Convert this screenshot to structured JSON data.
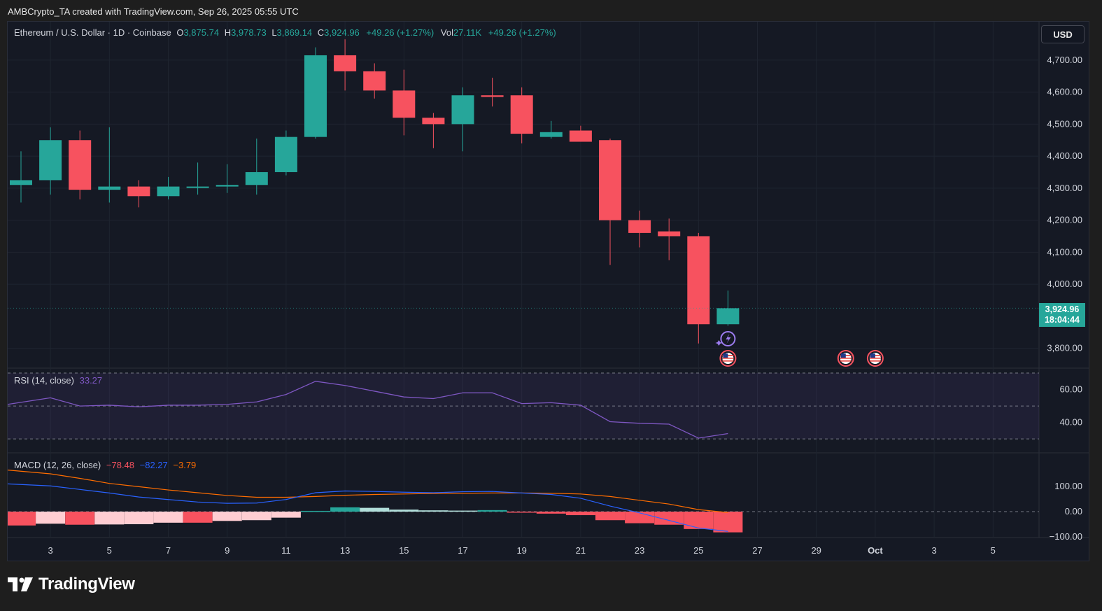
{
  "caption": "AMBCrypto_TA created with TradingView.com, Sep 26, 2025 05:55 UTC",
  "brand": "TradingView",
  "currency_button": "USD",
  "legend": {
    "symbol": "Ethereum / U.S. Dollar · 1D · Coinbase",
    "o_label": "O",
    "o_value": "3,875.74",
    "h_label": "H",
    "h_value": "3,978.73",
    "l_label": "L",
    "l_value": "3,869.14",
    "c_label": "C",
    "c_value": "3,924.96",
    "change": "+49.26 (+1.27%)",
    "vol_label": "Vol",
    "vol_value": "27.11K",
    "change2": "+49.26 (+1.27%)"
  },
  "rsi_legend": {
    "label": "RSI (14, close)",
    "value": "33.27"
  },
  "macd_legend": {
    "label": "MACD (12, 26, close)",
    "macd": "−78.48",
    "signal": "−82.27",
    "hist": "−3.79"
  },
  "last_price": {
    "value": "3,924.96",
    "countdown": "18:04:44"
  },
  "colors": {
    "up": "#26a69a",
    "down": "#f7525f",
    "rsi": "#7e57c2",
    "macd": "#2962ff",
    "signal": "#ff6d00",
    "hist_neg_strong": "#f7525f",
    "hist_neg_weak": "#ffcdd2",
    "hist_pos_strong": "#26a69a",
    "hist_pos_weak": "#b2dfdb"
  },
  "chart_data": [
    {
      "type": "candlestick",
      "title": "Ethereum / U.S. Dollar · 1D · Coinbase",
      "x_ticks": [
        "3",
        "5",
        "7",
        "9",
        "11",
        "13",
        "15",
        "17",
        "19",
        "21",
        "23",
        "25",
        "27",
        "29",
        "Oct",
        "3",
        "5"
      ],
      "y_ticks": [
        "3,800.00",
        "4,000.00",
        "4,100.00",
        "4,200.00",
        "4,300.00",
        "4,400.00",
        "4,500.00",
        "4,600.00",
        "4,700.00"
      ],
      "ylim": [
        3740,
        4820
      ],
      "candles": [
        {
          "date": "Sep 2",
          "o": 4310,
          "h": 4415,
          "l": 4255,
          "c": 4325
        },
        {
          "date": "Sep 3",
          "o": 4325,
          "h": 4490,
          "l": 4280,
          "c": 4450
        },
        {
          "date": "Sep 4",
          "o": 4450,
          "h": 4480,
          "l": 4265,
          "c": 4295
        },
        {
          "date": "Sep 5",
          "o": 4295,
          "h": 4490,
          "l": 4255,
          "c": 4305
        },
        {
          "date": "Sep 6",
          "o": 4305,
          "h": 4325,
          "l": 4240,
          "c": 4275
        },
        {
          "date": "Sep 7",
          "o": 4275,
          "h": 4335,
          "l": 4265,
          "c": 4305
        },
        {
          "date": "Sep 8",
          "o": 4305,
          "h": 4380,
          "l": 4280,
          "c": 4305
        },
        {
          "date": "Sep 9",
          "o": 4305,
          "h": 4375,
          "l": 4285,
          "c": 4310
        },
        {
          "date": "Sep 10",
          "o": 4310,
          "h": 4455,
          "l": 4280,
          "c": 4350
        },
        {
          "date": "Sep 11",
          "o": 4350,
          "h": 4480,
          "l": 4340,
          "c": 4460
        },
        {
          "date": "Sep 12",
          "o": 4460,
          "h": 4740,
          "l": 4455,
          "c": 4715
        },
        {
          "date": "Sep 13",
          "o": 4715,
          "h": 4765,
          "l": 4605,
          "c": 4665
        },
        {
          "date": "Sep 14",
          "o": 4665,
          "h": 4690,
          "l": 4580,
          "c": 4605
        },
        {
          "date": "Sep 15",
          "o": 4605,
          "h": 4670,
          "l": 4465,
          "c": 4520
        },
        {
          "date": "Sep 16",
          "o": 4520,
          "h": 4535,
          "l": 4425,
          "c": 4500
        },
        {
          "date": "Sep 17",
          "o": 4500,
          "h": 4615,
          "l": 4415,
          "c": 4590
        },
        {
          "date": "Sep 18",
          "o": 4590,
          "h": 4645,
          "l": 4555,
          "c": 4585
        },
        {
          "date": "Sep 19",
          "o": 4590,
          "h": 4615,
          "l": 4440,
          "c": 4470
        },
        {
          "date": "Sep 20",
          "o": 4460,
          "h": 4510,
          "l": 4455,
          "c": 4475
        },
        {
          "date": "Sep 21",
          "o": 4480,
          "h": 4495,
          "l": 4445,
          "c": 4445
        },
        {
          "date": "Sep 22",
          "o": 4450,
          "h": 4455,
          "l": 4060,
          "c": 4200
        },
        {
          "date": "Sep 23",
          "o": 4200,
          "h": 4230,
          "l": 4115,
          "c": 4160
        },
        {
          "date": "Sep 24",
          "o": 4165,
          "h": 4205,
          "l": 4075,
          "c": 4150
        },
        {
          "date": "Sep 25",
          "o": 4150,
          "h": 4160,
          "l": 3815,
          "c": 3875
        },
        {
          "date": "Sep 26",
          "o": 3875,
          "h": 3980,
          "l": 3870,
          "c": 3925
        }
      ]
    },
    {
      "type": "line",
      "title": "RSI (14, close)",
      "y_ticks": [
        "40.00",
        "60.00"
      ],
      "ylim": [
        22,
        73
      ],
      "bands": [
        30,
        50,
        70
      ],
      "series": [
        {
          "name": "RSI (14, close)",
          "values": [
            51,
            55,
            50,
            50.5,
            49.5,
            50.5,
            50.5,
            51,
            52.5,
            57,
            65,
            62.5,
            59,
            55.5,
            54.5,
            58,
            58,
            51.5,
            52,
            50.5,
            40.5,
            39.5,
            39,
            30.5,
            33.27
          ]
        }
      ]
    },
    {
      "type": "bar",
      "title": "MACD (12, 26, close)",
      "y_ticks": [
        "100.00",
        "0.00",
        "−100.00"
      ],
      "ylim": [
        -100,
        200
      ],
      "series": [
        {
          "name": "MACD",
          "values": [
            110,
            102,
            88,
            74,
            58,
            48,
            38,
            33,
            34,
            48,
            75,
            82,
            80,
            77,
            75,
            79,
            80,
            74,
            68,
            53,
            22,
            -5,
            -35,
            -65,
            -78.48
          ]
        },
        {
          "name": "Signal",
          "values": [
            165,
            150,
            132,
            112,
            99,
            86,
            75,
            64,
            57,
            57,
            60,
            65,
            68,
            70,
            72,
            73,
            74,
            74,
            73,
            70,
            60,
            45,
            30,
            8,
            -3.79
          ]
        },
        {
          "name": "Histogram",
          "values": [
            -55,
            -48,
            -52,
            -51,
            -50,
            -44,
            -44,
            -37,
            -34,
            -24,
            3,
            17,
            15,
            8,
            5,
            4,
            6,
            -4,
            -8,
            -14,
            -34,
            -46,
            -52,
            -69,
            -82.27
          ]
        }
      ]
    }
  ]
}
